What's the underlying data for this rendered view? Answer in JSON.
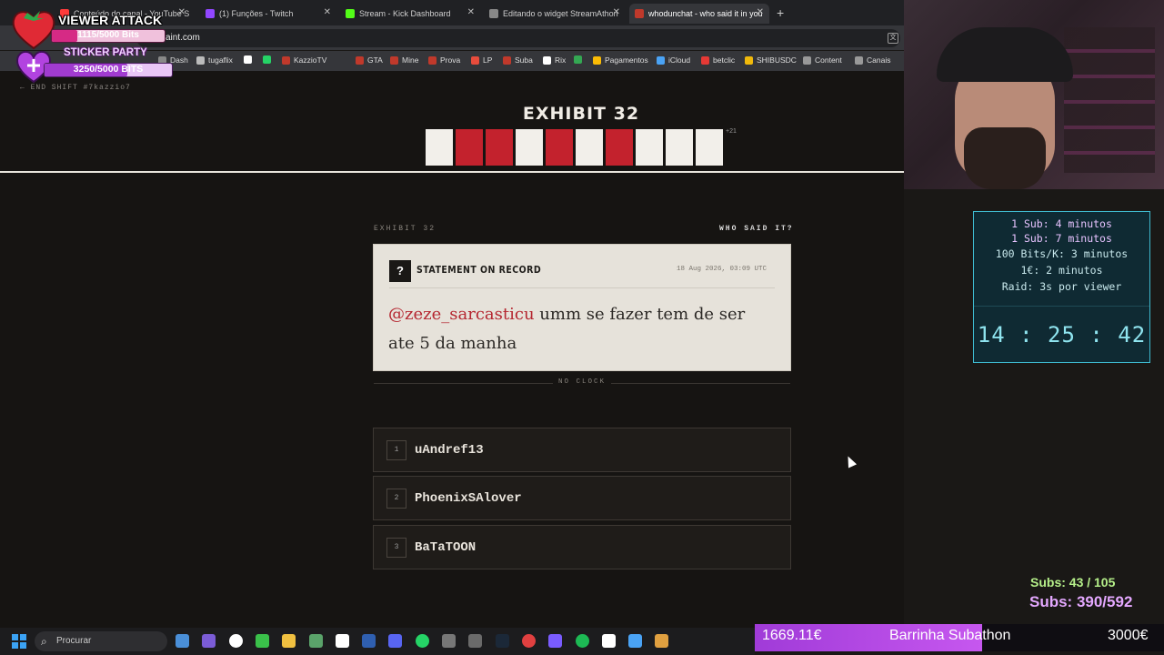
{
  "browser": {
    "tabs": [
      {
        "title": "Conteúdo do canal - YouTube S",
        "color": "#ff3b3b"
      },
      {
        "title": "(1) Funções - Twitch",
        "color": "#9147ff"
      },
      {
        "title": "Stream - Kick Dashboard",
        "color": "#53fc18"
      },
      {
        "title": "Editando o widget StreamAthon",
        "color": "#888888"
      },
      {
        "title": "whodunchat - who said it in you",
        "color": "#c0392b"
      }
    ],
    "url": "aint.com",
    "bookmarks": [
      "Dash",
      "tugaflix",
      "",
      "",
      "KazzioTV",
      "GTA",
      "Mine",
      "Prova",
      "LP",
      "Suba",
      "Rix",
      "",
      "Pagamentos",
      "iCloud",
      "betclic",
      "SHIBUSDC",
      "Content",
      "Canais"
    ]
  },
  "page": {
    "end_shift": "← END SHIFT  #7kazzio7",
    "exhibit_title": "EXHIBIT 32",
    "squares": [
      "white",
      "red",
      "red",
      "white",
      "red",
      "white",
      "red",
      "white",
      "white",
      "white"
    ],
    "more_count": "+21",
    "sub_exhibit": "EXHIBIT 32",
    "who_said": "WHO SAID IT?",
    "statement_label": "STATEMENT ON RECORD",
    "statement_date": "18 Aug 2026, 03:09 UTC",
    "mention": "@zeze_sarcasticu",
    "quote": " umm se fazer tem de ser ate 5 da manha",
    "no_clock": "NO CLOCK",
    "options": [
      {
        "num": "1",
        "name": "uAndref13"
      },
      {
        "num": "2",
        "name": "PhoenixSAlover"
      },
      {
        "num": "3",
        "name": "BaTaTOON"
      }
    ]
  },
  "overlay": {
    "viewer_attack": {
      "title": "VIEWER ATTACK",
      "bits1": "1115/5000 Bits",
      "bits1_progress": 0.223,
      "sticker": "STICKER PARTY",
      "bits2": "3250/5000 BITS",
      "bits2_progress": 0.65
    },
    "timer": {
      "lines": [
        "1 Sub: 4 minutos",
        "1 Sub: 7 minutos",
        "100 Bits/K: 3 minutos",
        "1€: 2 minutos",
        "Raid: 3s por viewer"
      ],
      "clock": "14 : 25 : 42"
    },
    "subs1": "Subs: 43 / 105",
    "subs2": "Subs: 390/592",
    "bar_left": "1669.11€",
    "bar_mid": "Barrinha Subathon",
    "bar_right": "3000€",
    "bar_progress": 0.556
  },
  "taskbar": {
    "search_placeholder": "Procurar"
  },
  "colors": {
    "red": "#c3222d",
    "white": "#f2efea",
    "accent_cyan": "#3fbbd0"
  }
}
